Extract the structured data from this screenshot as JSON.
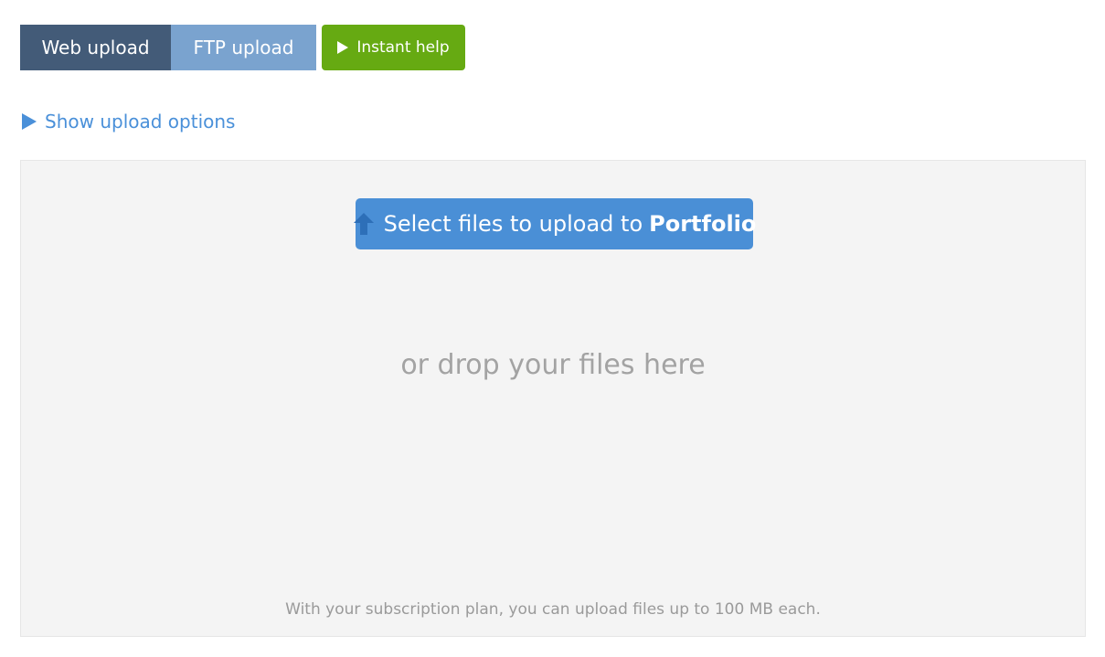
{
  "tabs": {
    "web_upload": "Web upload",
    "ftp_upload": "FTP upload"
  },
  "help": {
    "label": "Instant help",
    "icon": "play-icon"
  },
  "options": {
    "label": "Show upload options",
    "icon": "triangle-right-icon"
  },
  "dropzone": {
    "select_prefix": "Select files to upload to",
    "select_target": "Portfolio",
    "select_icon": "upload-arrow-icon",
    "drop_text": "or drop your files here",
    "plan_note": "With your subscription plan, you can upload files up to 100 MB each."
  },
  "colors": {
    "tab_active": "#435b78",
    "tab_inactive": "#7aa3cf",
    "help_green": "#66aa12",
    "link_blue": "#4a90d9",
    "button_blue": "#4a8fd6",
    "dropzone_bg": "#f4f4f4"
  }
}
